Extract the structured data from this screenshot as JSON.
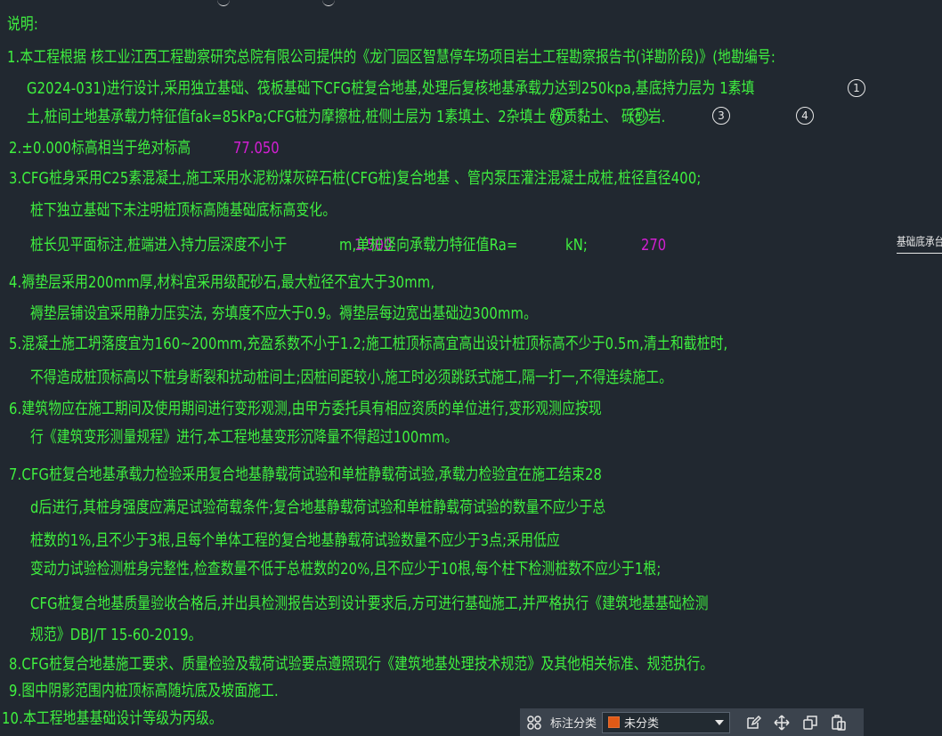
{
  "notes": {
    "heading": "说明:",
    "l1a": "1.本工程根据    核工业江西工程勘察研究总院有限公司提供的《龙门园区智慧停车场项目岩土工程勘察报告书(详勘阶段)》(地勘编号:",
    "l1b": "G2024-031)进行设计,采用独立基础、筏板基础下CFG桩复合地基,处理后复核地基承载力达到250kpa,基底持力层为   1素填",
    "l1c": "土,桩间土地基承载力特征值fak=85kPa;CFG桩为摩擦桩,桩侧土层为  1素填土、2杂填土  粉质黏土、  砾砂岩.",
    "l2": "2.±0.000标高相当于绝对标高",
    "l3a": "3.CFG桩身采用C25素混凝土,施工采用水泥粉煤灰碎石桩(CFG桩)复合地基 、管内泵压灌注混凝土成桩,桩径直径400;",
    "l3b": "桩下独立基础下未注明桩顶标高随基础底标高变化。",
    "l3c1": "桩长见平面标注,桩端进入持力层深度不小于",
    "l3c2": "m,单桩竖向承载力特征值Ra=",
    "l3c3": "kN;",
    "l4a": "4.褥垫层采用200mm厚,材料宜采用级配砂石,最大粒径不宜大于30mm,",
    "l4b": "褥垫层铺设宜采用静力压实法, 夯填度不应大于0.9。褥垫层每边宽出基础边300mm。",
    "l5a": "5.混凝土施工坍落度宜为160~200mm,充盈系数不小于1.2;施工桩顶标高宜高出设计桩顶标高不少于0.5m,清土和截桩时,",
    "l5b": "不得造成桩顶标高以下桩身断裂和扰动桩间土;因桩间距较小,施工时必须跳跃式施工,隔一打一,不得连续施工。",
    "l6a": "6.建筑物应在施工期间及使用期间进行变形观测,由甲方委托具有相应资质的单位进行,变形观测应按现",
    "l6b": "行《建筑变形测量规程》进行,本工程地基变形沉降量不得超过100mm。",
    "l7a": "7.CFG桩复合地基承载力检验采用复合地基静载荷试验和单桩静载荷试验,承载力检验宜在施工结束28",
    "l7b": "d后进行,其桩身强度应满足试验荷载条件;复合地基静载荷试验和单桩静载荷试验的数量不应少于总",
    "l7c": "桩数的1%,且不少于3根,且每个单体工程的复合地基静载荷试验数量不应少于3点;采用低应",
    "l7d": "变动力试验检测桩身完整性,检查数量不低于总桩数的20%,且不应少于10根,每个柱下检测桩数不应少于1根;",
    "l7e": "CFG桩复合地基质量验收合格后,并出具检测报告达到设计要求后,方可进行基础施工,并严格执行《建筑地基基础检测",
    "l7f": "规范》DBJ/T 15-60-2019。",
    "l8": "8.CFG桩复合地基施工要求、质量检验及载荷试验要点遵照现行《建筑地基处理技术规范》及其他相关标准、规范执行。",
    "l9": "9.图中阴影范围内桩顶标高随坑底及坡面施工.",
    "l10": "10.本工程地基基础设计等级为丙级。"
  },
  "magenta": {
    "elevation": "77.050",
    "depth": "1.500",
    "capacity": "270"
  },
  "circles": {
    "c1": "1",
    "c2": "1",
    "c3": "1",
    "c4": "3",
    "c5": "4"
  },
  "side_label": "基础底承台",
  "toolbar": {
    "label": "标注分类",
    "selected": "未分类",
    "swatch_color": "#e25a16"
  }
}
